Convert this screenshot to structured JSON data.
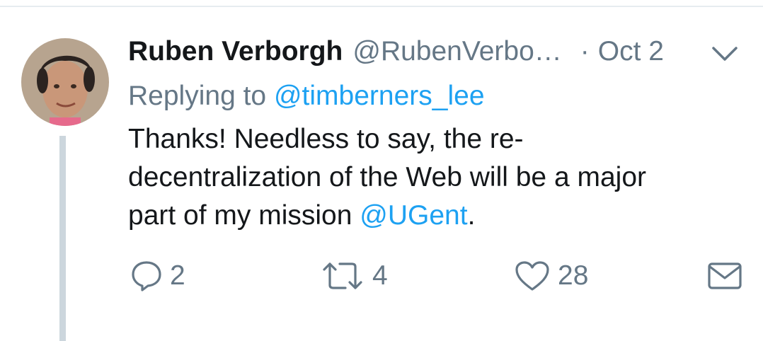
{
  "tweet": {
    "author": {
      "display_name": "Ruben Verborgh",
      "handle": "@RubenVerbo…",
      "avatar_icon": "user-avatar-photo"
    },
    "separator": "·",
    "date": "Oct 2",
    "replying_to": {
      "label": "Replying to",
      "mention": "@timberners_lee"
    },
    "text": {
      "line1": "Thanks! Needless to say, the re-",
      "line2": "decentralization of the Web will be a major",
      "line3_before": "part of my mission ",
      "line3_mention": "@UGent",
      "line3_after": "."
    },
    "actions": {
      "reply_count": "2",
      "retweet_count": "4",
      "like_count": "28"
    }
  },
  "colors": {
    "text": "#14171a",
    "secondary": "#657786",
    "link": "#1da1f2",
    "thread_line": "#ccd6dd"
  }
}
